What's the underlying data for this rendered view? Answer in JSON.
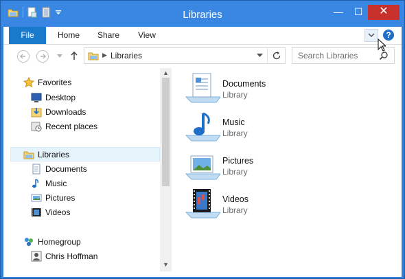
{
  "window": {
    "title": "Libraries"
  },
  "title_buttons": {
    "minimize": "—",
    "maximize": "☐",
    "close": "✕"
  },
  "ribbon": {
    "tabs": [
      {
        "label": "File"
      },
      {
        "label": "Home"
      },
      {
        "label": "Share"
      },
      {
        "label": "View"
      }
    ],
    "help": "?"
  },
  "address": {
    "path": "Libraries",
    "search_placeholder": "Search Libraries"
  },
  "nav": {
    "favorites": {
      "label": "Favorites",
      "items": [
        "Desktop",
        "Downloads",
        "Recent places"
      ]
    },
    "libraries": {
      "label": "Libraries",
      "items": [
        "Documents",
        "Music",
        "Pictures",
        "Videos"
      ]
    },
    "homegroup": {
      "label": "Homegroup",
      "items": [
        "Chris Hoffman"
      ]
    }
  },
  "libraries": [
    {
      "name": "Documents",
      "type": "Library",
      "icon": "documents-library-icon"
    },
    {
      "name": "Music",
      "type": "Library",
      "icon": "music-library-icon"
    },
    {
      "name": "Pictures",
      "type": "Library",
      "icon": "pictures-library-icon"
    },
    {
      "name": "Videos",
      "type": "Library",
      "icon": "videos-library-icon"
    }
  ],
  "colors": {
    "titlebar": "#3a86e3",
    "file_tab": "#1979ca",
    "close": "#c7302b",
    "selection": "#e5f3fb"
  }
}
